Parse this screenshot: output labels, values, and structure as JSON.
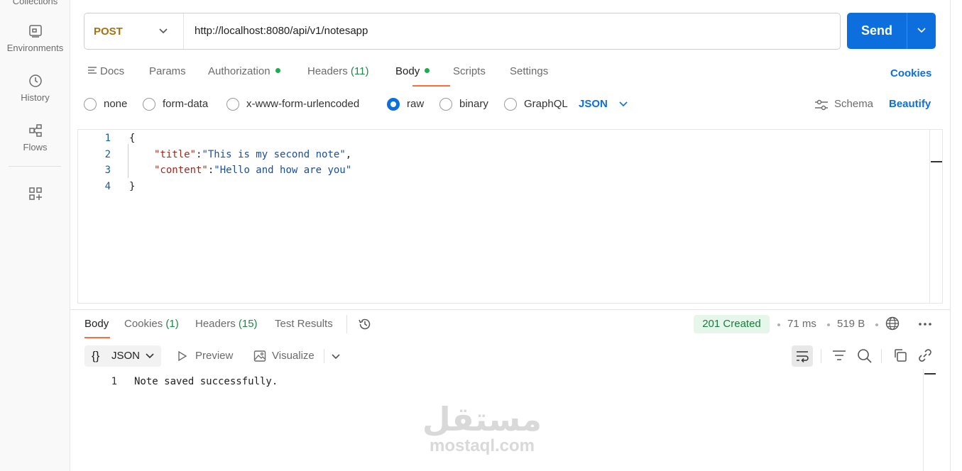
{
  "sidebar": {
    "items": [
      {
        "label": "Collections",
        "icon": "collections-icon"
      },
      {
        "label": "Environments",
        "icon": "environments-icon"
      },
      {
        "label": "History",
        "icon": "history-icon"
      },
      {
        "label": "Flows",
        "icon": "flows-icon"
      },
      {
        "label": "",
        "icon": "add-workbench-icon"
      }
    ]
  },
  "request": {
    "method": "POST",
    "method_color": "#a8700f",
    "url": "http://localhost:8080/api/v1/notesapp",
    "send_label": "Send",
    "send_color": "#0c6fdd"
  },
  "request_tabs": {
    "docs": "Docs",
    "params": "Params",
    "authorization": "Authorization",
    "headers": "Headers",
    "headers_count": "(11)",
    "body": "Body",
    "scripts": "Scripts",
    "settings": "Settings",
    "cookies": "Cookies"
  },
  "body_types": {
    "options": [
      "none",
      "form-data",
      "x-www-form-urlencoded",
      "raw",
      "binary",
      "GraphQL"
    ],
    "selected": "raw",
    "format": "JSON",
    "schema": "Schema",
    "beautify": "Beautify"
  },
  "editor": {
    "lines": [
      {
        "n": "1",
        "indent": "",
        "open": "{"
      },
      {
        "n": "2",
        "key": "\"title\"",
        "colon": ":",
        "value": "\"This is my second note\"",
        "tail": ","
      },
      {
        "n": "3",
        "key": "\"content\"",
        "colon": ":",
        "value": "\"Hello and how are you\"",
        "tail": ""
      },
      {
        "n": "4",
        "close": "}"
      }
    ]
  },
  "response": {
    "tabs": {
      "body": "Body",
      "cookies": "Cookies",
      "cookies_count": "(1)",
      "headers": "Headers",
      "headers_count": "(15)",
      "test_results": "Test Results"
    },
    "status": "201 Created",
    "time": "71 ms",
    "size": "519 B",
    "format": "JSON",
    "preview": "Preview",
    "visualize": "Visualize",
    "output_line": "1",
    "output_text": "Note saved successfully."
  },
  "watermark": {
    "arabic": "مستقل",
    "latin": "mostaql.com"
  }
}
